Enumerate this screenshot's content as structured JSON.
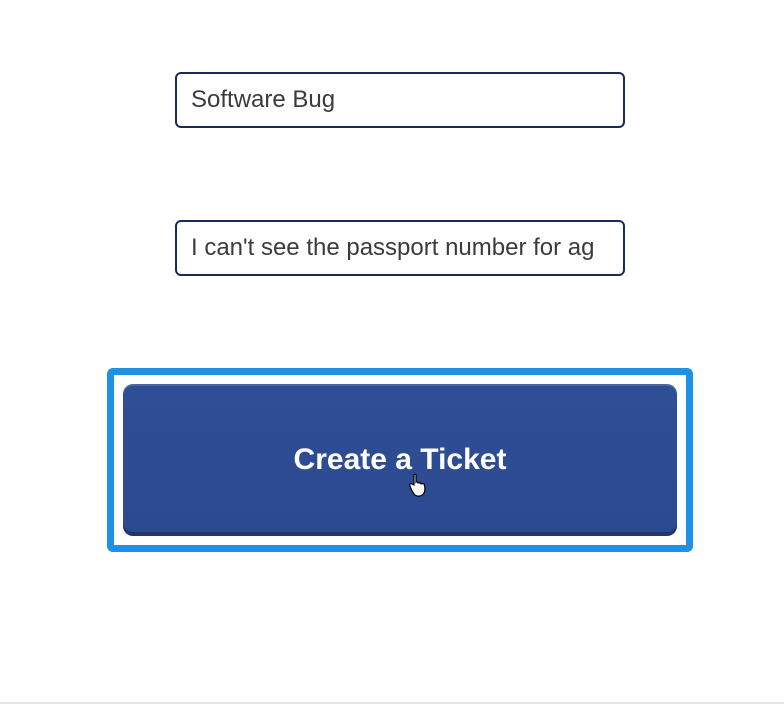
{
  "form": {
    "subject": "Software Bug",
    "body": "I can't see the passport number for ag"
  },
  "actions": {
    "create_ticket_label": "Create a Ticket"
  },
  "colors": {
    "field_border": "#1a2a56",
    "button_bg": "#2c4a8f",
    "highlight_border": "#1e90e6"
  }
}
